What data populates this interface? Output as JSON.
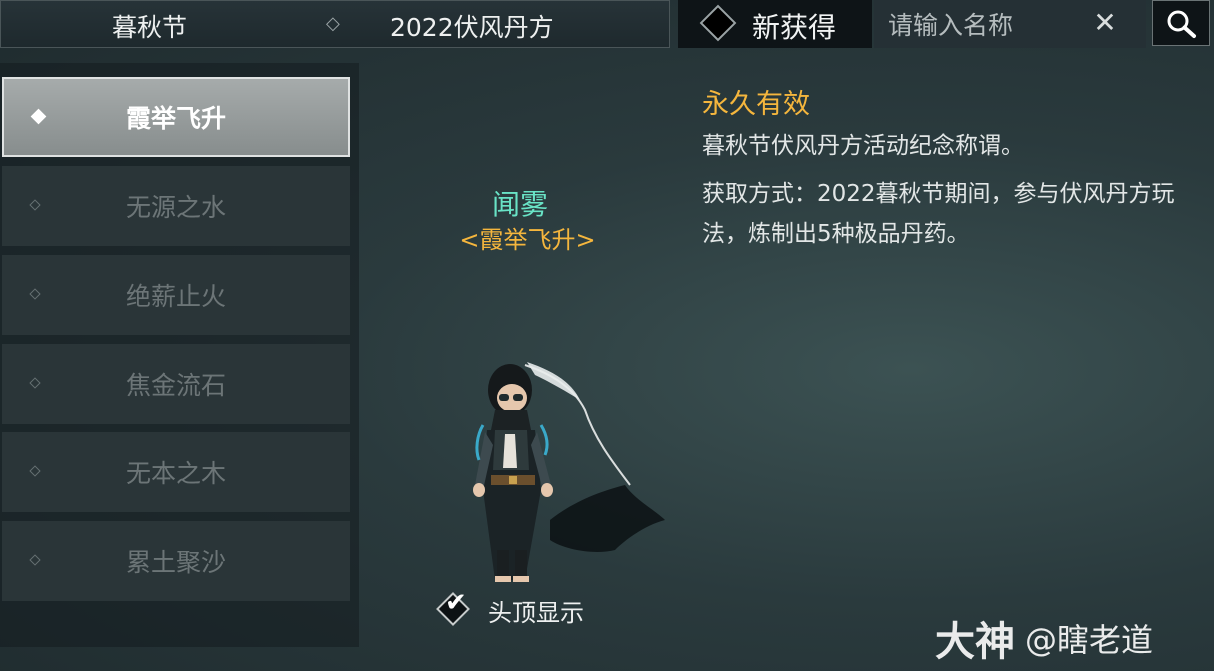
{
  "topbar": {
    "category_primary": "暮秋节",
    "category_separator": "◇",
    "category_secondary": "2022伏风丹方",
    "new_label": "新获得",
    "search_placeholder": "请输入名称",
    "clear_symbol": "✕"
  },
  "sidebar": {
    "items": [
      {
        "label": "霞举飞升",
        "active": true
      },
      {
        "label": "无源之水",
        "active": false
      },
      {
        "label": "绝薪止火",
        "active": false
      },
      {
        "label": "焦金流石",
        "active": false
      },
      {
        "label": "无本之木",
        "active": false
      },
      {
        "label": "累土聚沙",
        "active": false
      }
    ]
  },
  "preview": {
    "character_name": "闻雾",
    "title_display": "<霞举飞升>",
    "show_overhead_label": "头顶显示",
    "show_overhead_checked": true
  },
  "detail": {
    "validity": "永久有效",
    "description": "暮秋节伏风丹方活动纪念称谓。",
    "how_to_obtain": "获取方式：2022暮秋节期间，参与伏风丹方玩法，炼制出5种极品丹药。"
  },
  "watermark": {
    "brand": "大神",
    "user": "@瞎老道"
  },
  "colors": {
    "accent_gold": "#f5b63d",
    "name_teal": "#69e3c6"
  }
}
